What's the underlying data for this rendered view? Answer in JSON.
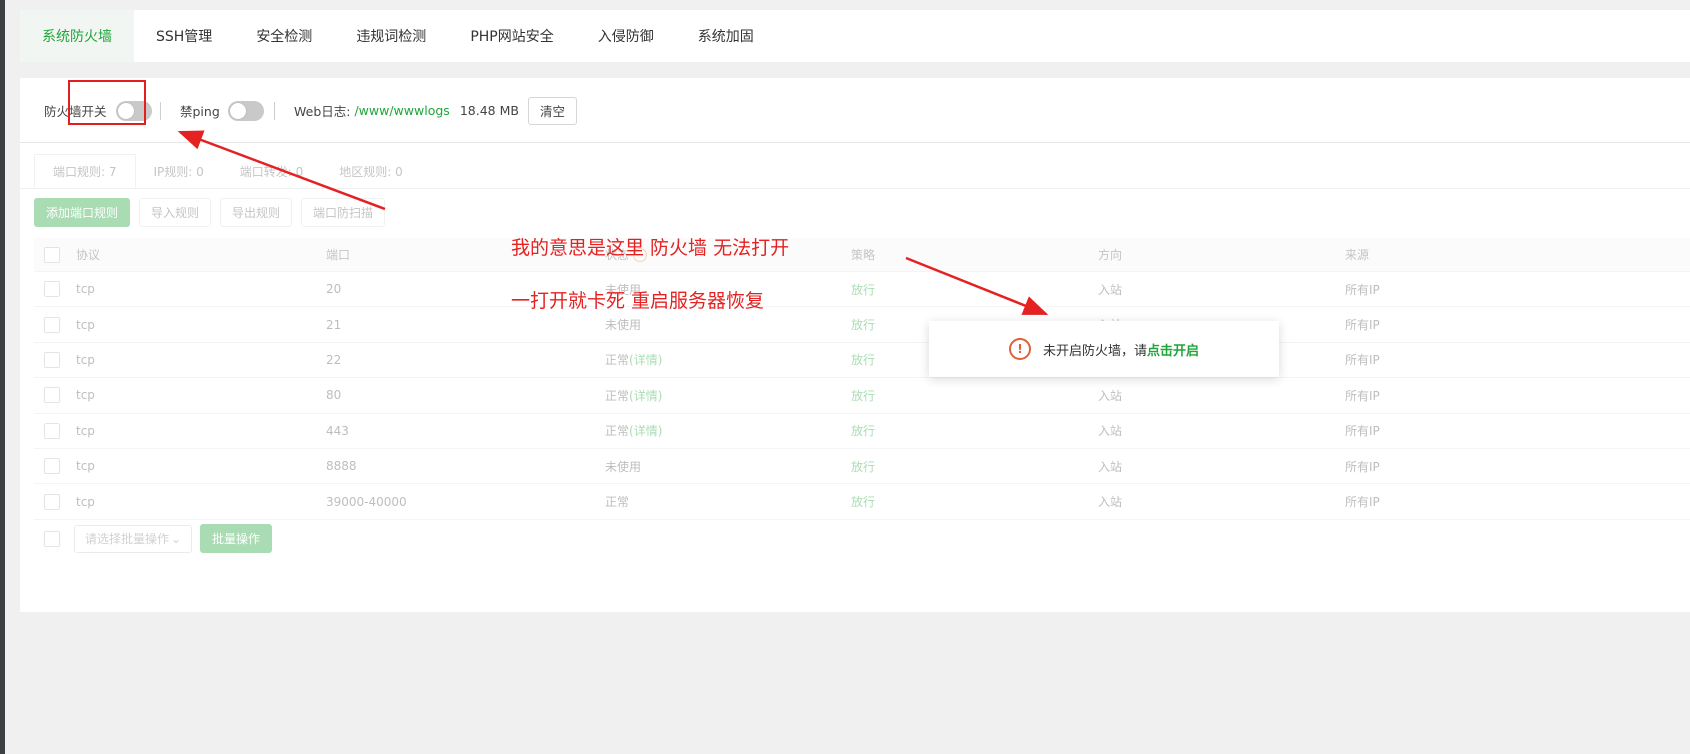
{
  "topnav": {
    "tabs": [
      "系统防火墙",
      "SSH管理",
      "安全检测",
      "违规词检测",
      "PHP网站安全",
      "入侵防御",
      "系统加固"
    ]
  },
  "toolbar": {
    "firewall_switch_label": "防火墙开关",
    "ping_label": "禁ping",
    "web_log_label": "Web日志:",
    "web_log_path": "/www/wwwlogs",
    "web_log_size": "18.48 MB",
    "clear_label": "清空"
  },
  "subtabs": [
    "端口规则: 7",
    "IP规则: 0",
    "端口转发: 0",
    "地区规则: 0"
  ],
  "actions": [
    "添加端口规则",
    "导入规则",
    "导出规则",
    "端口防扫描"
  ],
  "table": {
    "headers": [
      "协议",
      "端口",
      "状态",
      "策略",
      "方向",
      "来源"
    ],
    "rows": [
      {
        "protocol": "tcp",
        "port": "20",
        "status": "未使用",
        "detail": "",
        "policy": "放行",
        "direction": "入站",
        "source": "所有IP"
      },
      {
        "protocol": "tcp",
        "port": "21",
        "status": "未使用",
        "detail": "",
        "policy": "放行",
        "direction": "入站",
        "source": "所有IP"
      },
      {
        "protocol": "tcp",
        "port": "22",
        "status": "正常",
        "detail": "(详情)",
        "policy": "放行",
        "direction": "入站",
        "source": "所有IP"
      },
      {
        "protocol": "tcp",
        "port": "80",
        "status": "正常",
        "detail": "(详情)",
        "policy": "放行",
        "direction": "入站",
        "source": "所有IP"
      },
      {
        "protocol": "tcp",
        "port": "443",
        "status": "正常",
        "detail": "(详情)",
        "policy": "放行",
        "direction": "入站",
        "source": "所有IP"
      },
      {
        "protocol": "tcp",
        "port": "8888",
        "status": "未使用",
        "detail": "",
        "policy": "放行",
        "direction": "入站",
        "source": "所有IP"
      },
      {
        "protocol": "tcp",
        "port": "39000-40000",
        "status": "正常",
        "detail": "",
        "policy": "放行",
        "direction": "入站",
        "source": "所有IP"
      }
    ]
  },
  "batch": {
    "select_placeholder": "请选择批量操作",
    "button_label": "批量操作"
  },
  "annotation": {
    "line1": "我的意思是这里 防火墙 无法打开",
    "line2": "一打开就卡死     重启服务器恢复"
  },
  "toast": {
    "text": "未开启防火墙，请",
    "link": "点击开启"
  },
  "colors": {
    "accent": "#20a53a",
    "annotation_red": "#e52222",
    "warning": "#e0603a"
  }
}
